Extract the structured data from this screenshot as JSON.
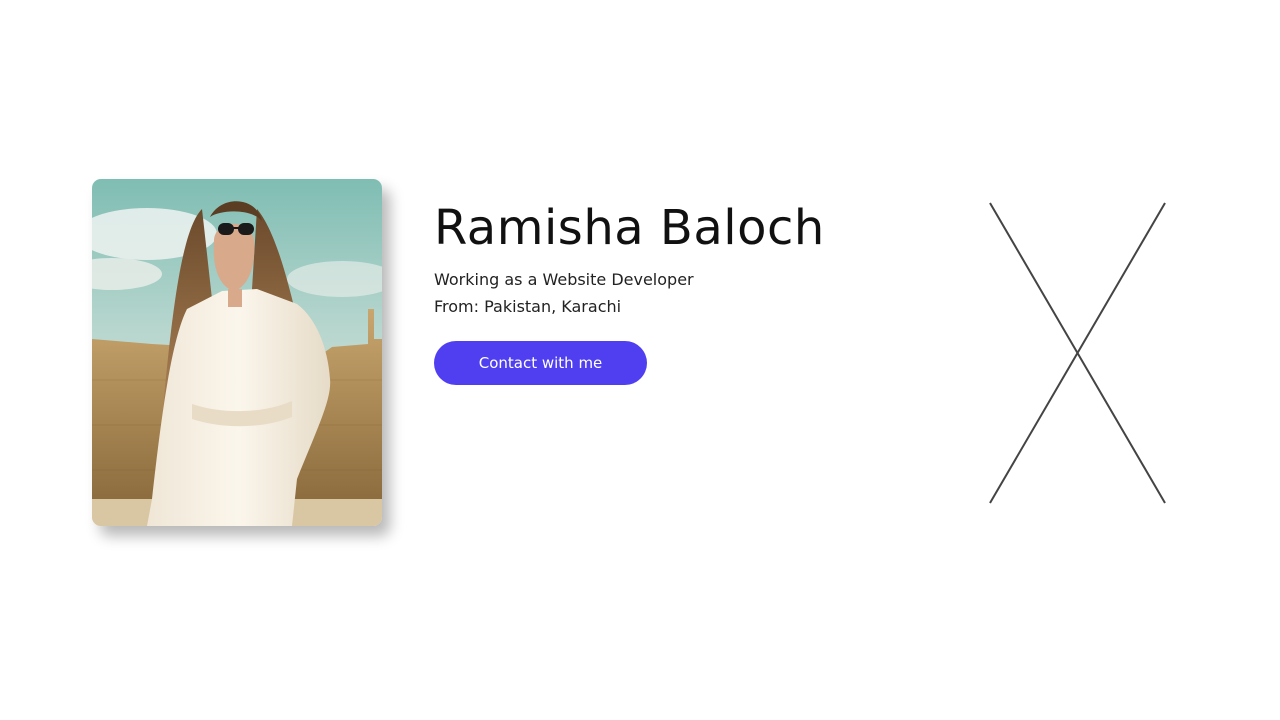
{
  "profile": {
    "name": "Ramisha Baloch",
    "role": "Working as a Website Developer",
    "location": "From: Pakistan, Karachi",
    "contact_label": "Contact with me"
  },
  "icons": {
    "close": "close-icon",
    "photo": "profile-photo"
  },
  "colors": {
    "accent": "#4f3ff0",
    "close_stroke": "#444444",
    "text": "#111111"
  }
}
